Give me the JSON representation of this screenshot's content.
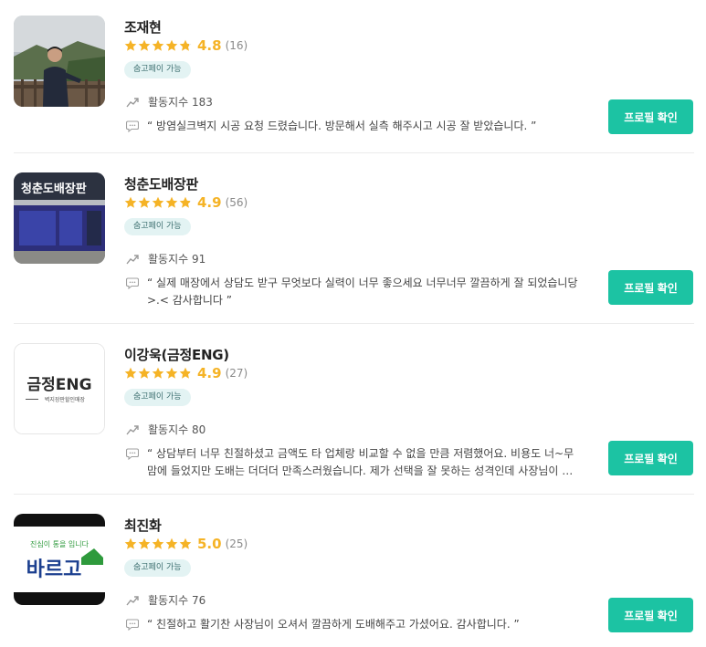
{
  "experts": [
    {
      "name": "조재현",
      "score": "4.8",
      "review_count": "(16)",
      "stars": 4.8,
      "badge": "숨고페이 가능",
      "activity": "활동지수 183",
      "review": "“ 방염실크벽지 시공 요청 드렸습니다. 방문해서 실측 해주시고 시공 잘 받았습니다. ”",
      "button": "프로필 확인"
    },
    {
      "name": "청춘도배장판",
      "score": "4.9",
      "review_count": "(56)",
      "stars": 4.9,
      "badge": "숨고페이 가능",
      "activity": "활동지수 91",
      "review": "“ 실제 매장에서 상담도 받구 무엇보다 실력이 너무 좋으세요 너무너무 깔끔하게 잘 되었습니당 >.< 감사합니다 ”",
      "button": "프로필 확인",
      "thumb_text": "청춘도배장판"
    },
    {
      "name": "이강욱(금정ENG)",
      "score": "4.9",
      "review_count": "(27)",
      "stars": 4.9,
      "badge": "숨고페이 가능",
      "activity": "활동지수 80",
      "review": "“ 상담부터 너무 친절하셨고 금액도 타 업체랑 비교할 수 없을 만큼 저렴했어요. 비용도 너~무 맘에 들었지만 도배는 더더더 만족스러웠습니다. 제가 선택을 잘 못하는 성격인데 사장님이 경험…",
      "button": "프로필 확인",
      "logo_main": "금정ENG",
      "logo_sub": "벽지장판할인매장"
    },
    {
      "name": "최진화",
      "score": "5.0",
      "review_count": "(25)",
      "stars": 5.0,
      "badge": "숨고페이 가능",
      "activity": "활동지수 76",
      "review": "“ 친절하고 활기찬 사장님이 오셔서 깔끔하게 도배해주고 가셨어요. 감사합니다. ”",
      "button": "프로필 확인",
      "logo_top": "진심이 통을 입니다",
      "logo_main": "바르고"
    }
  ],
  "colors": {
    "star": "#f5b326",
    "button": "#1cc3a3",
    "badge_bg": "#e3f3f3",
    "badge_text": "#3d6f70"
  },
  "icons": {
    "activity": "trend-up-icon",
    "review": "speech-bubble-icon",
    "rating": "star-icon"
  }
}
